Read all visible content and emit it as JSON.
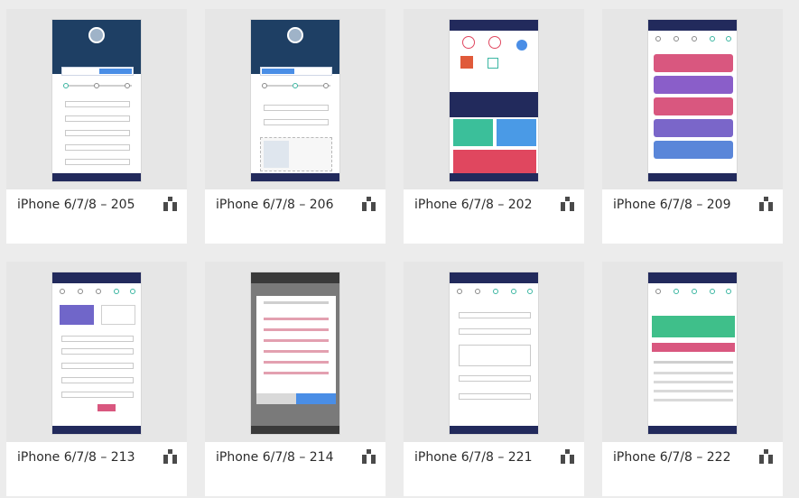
{
  "cards": [
    {
      "title": "iPhone 6/7/8 – 205"
    },
    {
      "title": "iPhone 6/7/8 – 206"
    },
    {
      "title": "iPhone 6/7/8 – 202"
    },
    {
      "title": "iPhone 6/7/8 – 209"
    },
    {
      "title": "iPhone 6/7/8 – 213"
    },
    {
      "title": "iPhone 6/7/8 – 214"
    },
    {
      "title": "iPhone 6/7/8 – 221"
    },
    {
      "title": "iPhone 6/7/8 – 222"
    }
  ],
  "colors": {
    "navy": "#222a5c",
    "teal": "#3bb6a2",
    "blue": "#4a8ee6",
    "red": "#e0475f",
    "pink": "#d9577f",
    "purple": "#7066c9",
    "green": "#3fbf8a"
  },
  "icons": {
    "mode": "component-tree-icon"
  }
}
